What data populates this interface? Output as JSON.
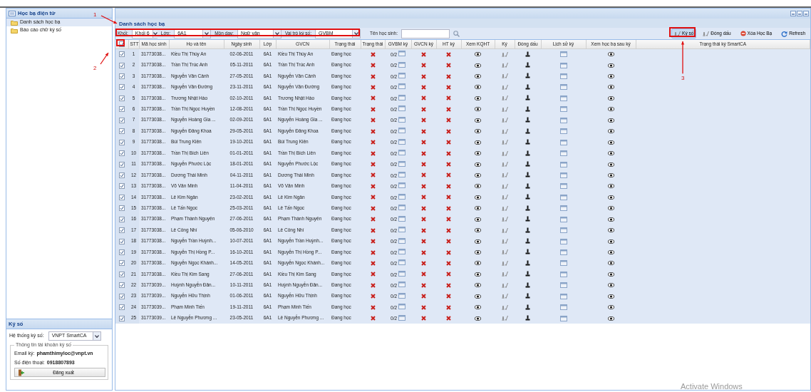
{
  "left_panel": {
    "title": "Học bạ điện tử",
    "items": [
      {
        "label": "Danh sách học bạ",
        "selected": true
      },
      {
        "label": "Báo cáo chữ ký số",
        "selected": false
      }
    ]
  },
  "sign_panel": {
    "title": "Ký số",
    "system_label": "Hệ thống ký số:",
    "system_value": "VNPT SmartCA",
    "account_legend": "Thông tin tài khoản ký số",
    "email_label": "Email ký:",
    "email": "phamthimyloc@vnpt.vn",
    "phone_label": "Số điện thoại:",
    "phone": "0918807893",
    "logout": "Đăng xuất"
  },
  "main": {
    "title": "Danh sách học bạ",
    "filters": [
      {
        "label": "Khối:",
        "value": "Khối 6"
      },
      {
        "label": "Lớp:",
        "value": "6A1"
      },
      {
        "label": "Môn dạy:",
        "value": "Ngữ văn"
      },
      {
        "label": "Vai trò ký số:",
        "value": "GVBM"
      }
    ],
    "search": {
      "label": "Tên học sinh:"
    },
    "actions": [
      {
        "label": "Ký số",
        "kind": "sign",
        "selected": true
      },
      {
        "label": "Đóng dấu",
        "kind": "stamp",
        "selected": false
      },
      {
        "label": "Xóa Học Bạ",
        "kind": "delete",
        "selected": false
      },
      {
        "label": "Refresh",
        "kind": "refresh",
        "selected": false
      }
    ]
  },
  "table": {
    "all_checked": true,
    "columns": [
      "STT",
      "Mã học sinh",
      "Họ và tên",
      "Ngày sinh",
      "Lớp",
      "GVCN",
      "Trạng thái",
      "Trạng thái",
      "GVBM ký",
      "GVCN ký",
      "HT ký",
      "Xem KQHT",
      "Ký",
      "Đóng dấu",
      "Lịch sử ký",
      "Xem học bạ sau ký",
      "Trạng thái ký SmartCA"
    ],
    "rows": [
      {
        "checked": true,
        "stt": "1",
        "student_id": "31773038...",
        "name": "Kiều Thị Thúy An",
        "birth_date": "02-06-2011",
        "class": "6A1",
        "homeroom_teacher": "Kiều Thị Thúy An",
        "status": "Đang học",
        "state_ok": false,
        "gvbm_count": "0/2",
        "gvcn_signed": false,
        "ht_signed": false
      },
      {
        "checked": true,
        "stt": "2",
        "student_id": "31773038...",
        "name": "Trần Thị Trúc Anh",
        "birth_date": "05-11-2011",
        "class": "6A1",
        "homeroom_teacher": "Trần Thị Trúc Anh",
        "status": "Đang học",
        "state_ok": false,
        "gvbm_count": "0/2",
        "gvcn_signed": false,
        "ht_signed": false
      },
      {
        "checked": true,
        "stt": "3",
        "student_id": "31773038...",
        "name": "Nguyễn Văn Cảnh",
        "birth_date": "27-05-2011",
        "class": "6A1",
        "homeroom_teacher": "Nguyễn Văn Cảnh",
        "status": "Đang học",
        "state_ok": false,
        "gvbm_count": "0/2",
        "gvcn_signed": false,
        "ht_signed": false
      },
      {
        "checked": true,
        "stt": "4",
        "student_id": "31773038...",
        "name": "Nguyễn Văn Đường",
        "birth_date": "23-11-2011",
        "class": "6A1",
        "homeroom_teacher": "Nguyễn Văn Đường",
        "status": "Đang học",
        "state_ok": false,
        "gvbm_count": "0/2",
        "gvcn_signed": false,
        "ht_signed": false
      },
      {
        "checked": true,
        "stt": "5",
        "student_id": "31773038...",
        "name": "Trương Nhật Hào",
        "birth_date": "02-10-2011",
        "class": "6A1",
        "homeroom_teacher": "Trương Nhật Hào",
        "status": "Đang học",
        "state_ok": false,
        "gvbm_count": "0/2",
        "gvcn_signed": false,
        "ht_signed": false
      },
      {
        "checked": true,
        "stt": "6",
        "student_id": "31773038...",
        "name": "Trần Thị Ngọc Huyền",
        "birth_date": "12-08-2011",
        "class": "6A1",
        "homeroom_teacher": "Trần Thị Ngọc Huyền",
        "status": "Đang học",
        "state_ok": false,
        "gvbm_count": "0/2",
        "gvcn_signed": false,
        "ht_signed": false
      },
      {
        "checked": true,
        "stt": "7",
        "student_id": "31773038...",
        "name": "Nguyễn Hoàng Gia ...",
        "birth_date": "02-09-2011",
        "class": "6A1",
        "homeroom_teacher": "Nguyễn Hoàng Gia ...",
        "status": "Đang học",
        "state_ok": false,
        "gvbm_count": "0/2",
        "gvcn_signed": false,
        "ht_signed": false
      },
      {
        "checked": true,
        "stt": "8",
        "student_id": "31773038...",
        "name": "Nguyễn Đăng Khoa",
        "birth_date": "29-05-2011",
        "class": "6A1",
        "homeroom_teacher": "Nguyễn Đăng Khoa",
        "status": "Đang học",
        "state_ok": false,
        "gvbm_count": "0/2",
        "gvcn_signed": false,
        "ht_signed": false
      },
      {
        "checked": true,
        "stt": "9",
        "student_id": "31773038...",
        "name": "Bùi Trung Kiên",
        "birth_date": "19-10-2011",
        "class": "6A1",
        "homeroom_teacher": "Bùi Trung Kiên",
        "status": "Đang học",
        "state_ok": false,
        "gvbm_count": "0/2",
        "gvcn_signed": false,
        "ht_signed": false
      },
      {
        "checked": true,
        "stt": "10",
        "student_id": "31773038...",
        "name": "Trần Thị Bích Liên",
        "birth_date": "01-01-2011",
        "class": "6A1",
        "homeroom_teacher": "Trần Thị Bích Liên",
        "status": "Đang học",
        "state_ok": false,
        "gvbm_count": "0/2",
        "gvcn_signed": false,
        "ht_signed": false
      },
      {
        "checked": true,
        "stt": "11",
        "student_id": "31773038...",
        "name": "Nguyễn Phước Lộc",
        "birth_date": "18-01-2011",
        "class": "6A1",
        "homeroom_teacher": "Nguyễn Phước Lộc",
        "status": "Đang học",
        "state_ok": false,
        "gvbm_count": "0/2",
        "gvcn_signed": false,
        "ht_signed": false
      },
      {
        "checked": true,
        "stt": "12",
        "student_id": "31773038...",
        "name": "Dương Thái Minh",
        "birth_date": "04-11-2011",
        "class": "6A1",
        "homeroom_teacher": "Dương Thái Minh",
        "status": "Đang học",
        "state_ok": false,
        "gvbm_count": "0/2",
        "gvcn_signed": false,
        "ht_signed": false
      },
      {
        "checked": true,
        "stt": "13",
        "student_id": "31773038...",
        "name": "Võ Văn Minh",
        "birth_date": "11-04-2011",
        "class": "6A1",
        "homeroom_teacher": "Võ Văn Minh",
        "status": "Đang học",
        "state_ok": false,
        "gvbm_count": "0/2",
        "gvcn_signed": false,
        "ht_signed": false
      },
      {
        "checked": true,
        "stt": "14",
        "student_id": "31773038...",
        "name": "Lê Kim Ngân",
        "birth_date": "23-02-2011",
        "class": "6A1",
        "homeroom_teacher": "Lê Kim Ngân",
        "status": "Đang học",
        "state_ok": false,
        "gvbm_count": "0/2",
        "gvcn_signed": false,
        "ht_signed": false
      },
      {
        "checked": true,
        "stt": "15",
        "student_id": "31773038...",
        "name": "Lê Tấn Ngọc",
        "birth_date": "25-03-2011",
        "class": "6A1",
        "homeroom_teacher": "Lê Tấn Ngọc",
        "status": "Đang học",
        "state_ok": false,
        "gvbm_count": "0/2",
        "gvcn_signed": false,
        "ht_signed": false
      },
      {
        "checked": true,
        "stt": "16",
        "student_id": "31773038...",
        "name": "Phạm Thành Nguyên",
        "birth_date": "27-06-2011",
        "class": "6A1",
        "homeroom_teacher": "Phạm Thành Nguyên",
        "status": "Đang học",
        "state_ok": false,
        "gvbm_count": "0/2",
        "gvcn_signed": false,
        "ht_signed": false
      },
      {
        "checked": true,
        "stt": "17",
        "student_id": "31773038...",
        "name": "Lê Công Nhí",
        "birth_date": "05-06-2010",
        "class": "6A1",
        "homeroom_teacher": "Lê Công Nhí",
        "status": "Đang học",
        "state_ok": false,
        "gvbm_count": "0/2",
        "gvcn_signed": false,
        "ht_signed": false
      },
      {
        "checked": true,
        "stt": "18",
        "student_id": "31773038...",
        "name": "Nguyễn Trần Huỳnh...",
        "birth_date": "10-07-2011",
        "class": "6A1",
        "homeroom_teacher": "Nguyễn Trần Huỳnh...",
        "status": "Đang học",
        "state_ok": false,
        "gvbm_count": "0/2",
        "gvcn_signed": false,
        "ht_signed": false
      },
      {
        "checked": true,
        "stt": "19",
        "student_id": "31773038...",
        "name": "Nguyễn Thị Hồng P...",
        "birth_date": "16-10-2011",
        "class": "6A1",
        "homeroom_teacher": "Nguyễn Thị Hồng P...",
        "status": "Đang học",
        "state_ok": false,
        "gvbm_count": "0/2",
        "gvcn_signed": false,
        "ht_signed": false
      },
      {
        "checked": true,
        "stt": "20",
        "student_id": "31773038...",
        "name": "Nguyễn Ngọc Khánh...",
        "birth_date": "14-05-2011",
        "class": "6A1",
        "homeroom_teacher": "Nguyễn Ngọc Khánh...",
        "status": "Đang học",
        "state_ok": false,
        "gvbm_count": "0/2",
        "gvcn_signed": false,
        "ht_signed": false
      },
      {
        "checked": true,
        "stt": "21",
        "student_id": "31773038...",
        "name": "Kiều Thị Kim Sang",
        "birth_date": "27-06-2011",
        "class": "6A1",
        "homeroom_teacher": "Kiều Thị Kim Sang",
        "status": "Đang học",
        "state_ok": false,
        "gvbm_count": "0/2",
        "gvcn_signed": false,
        "ht_signed": false
      },
      {
        "checked": true,
        "stt": "22",
        "student_id": "31773039...",
        "name": "Huỳnh Nguyễn Đăn...",
        "birth_date": "10-11-2011",
        "class": "6A1",
        "homeroom_teacher": "Huỳnh Nguyễn Đăn...",
        "status": "Đang học",
        "state_ok": false,
        "gvbm_count": "0/2",
        "gvcn_signed": false,
        "ht_signed": false
      },
      {
        "checked": true,
        "stt": "23",
        "student_id": "31773039...",
        "name": "Nguyễn Hữu Thịnh",
        "birth_date": "01-06-2011",
        "class": "6A1",
        "homeroom_teacher": "Nguyễn Hữu Thịnh",
        "status": "Đang học",
        "state_ok": false,
        "gvbm_count": "0/2",
        "gvcn_signed": false,
        "ht_signed": false
      },
      {
        "checked": true,
        "stt": "24",
        "student_id": "31773039...",
        "name": "Phạm Minh Tiến",
        "birth_date": "19-11-2011",
        "class": "6A1",
        "homeroom_teacher": "Phạm Minh Tiến",
        "status": "Đang học",
        "state_ok": false,
        "gvbm_count": "0/2",
        "gvcn_signed": false,
        "ht_signed": false
      },
      {
        "checked": true,
        "stt": "25",
        "student_id": "31773039...",
        "name": "Lê Nguyễn Phương ...",
        "birth_date": "23-05-2011",
        "class": "6A1",
        "homeroom_teacher": "Lê Nguyễn Phương ...",
        "status": "Đang học",
        "state_ok": false,
        "gvbm_count": "0/2",
        "gvcn_signed": false,
        "ht_signed": false
      }
    ]
  },
  "annotations": [
    {
      "label": "1"
    },
    {
      "label": "2"
    },
    {
      "label": "3"
    }
  ],
  "os_notice": "Activate Windows"
}
